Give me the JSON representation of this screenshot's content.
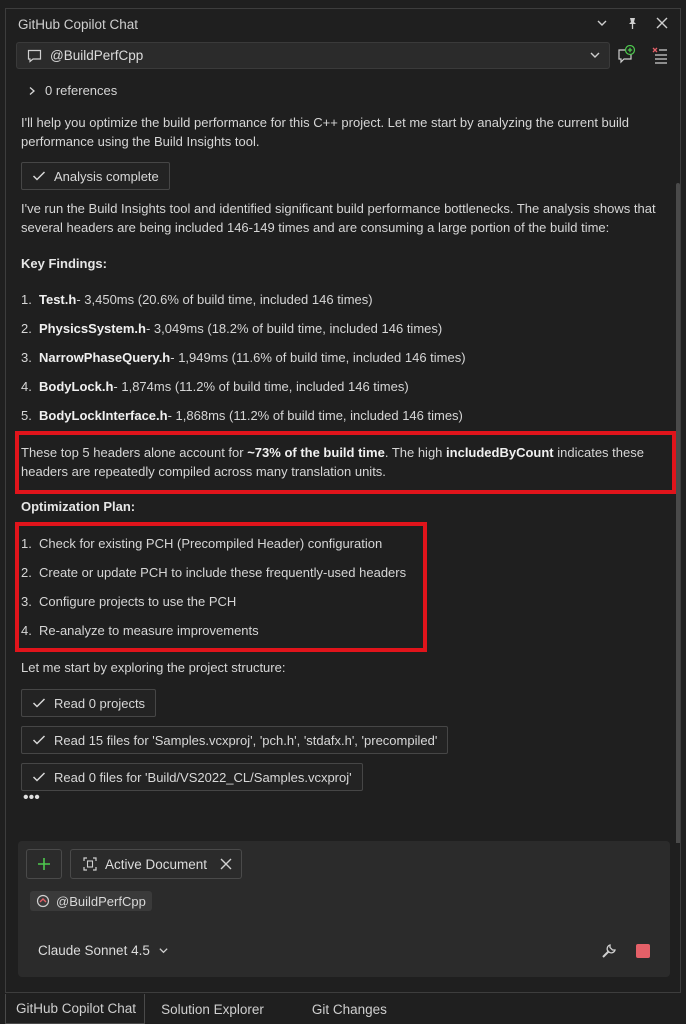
{
  "window": {
    "title": "GitHub Copilot Chat"
  },
  "agent_select": {
    "value": "@BuildPerfCpp"
  },
  "references": {
    "label": "0 references"
  },
  "intro": "I'll help you optimize the build performance for this C++ project. Let me start by analyzing the current build performance using the Build Insights tool.",
  "analysis_chip": "Analysis complete",
  "summary": "I've run the Build Insights tool and identified significant build performance bottlenecks. The analysis shows that several headers are being included 146-149 times and are consuming a large portion of the build time:",
  "findings": {
    "heading": "Key Findings:",
    "items": [
      {
        "num": "1.",
        "name": "Test.h",
        "detail": " - 3,450ms (20.6% of build time, included 146 times)"
      },
      {
        "num": "2.",
        "name": "PhysicsSystem.h",
        "detail": " - 3,049ms (18.2% of build time, included 146 times)"
      },
      {
        "num": "3.",
        "name": "NarrowPhaseQuery.h",
        "detail": " - 1,949ms (11.6% of build time, included 146 times)"
      },
      {
        "num": "4.",
        "name": "BodyLock.h",
        "detail": " - 1,874ms (11.2% of build time, included 146 times)"
      },
      {
        "num": "5.",
        "name": "BodyLockInterface.h",
        "detail": " - 1,868ms (11.2% of build time, included 146 times)"
      }
    ]
  },
  "highlight": {
    "part1": "These top 5 headers alone account for ",
    "bold1": "~73% of the build time",
    "part2": ". The high ",
    "bold2": "includedByCount",
    "part3": " indicates these headers are repeatedly compiled across many translation units."
  },
  "plan": {
    "heading": "Optimization Plan:",
    "items": [
      {
        "num": "1.",
        "text": "Check for existing PCH (Precompiled Header) configuration"
      },
      {
        "num": "2.",
        "text": "Create or update PCH to include these frequently-used headers"
      },
      {
        "num": "3.",
        "text": "Configure projects to use the PCH"
      },
      {
        "num": "4.",
        "text": "Re-analyze to measure improvements"
      }
    ]
  },
  "explore": "Let me start by exploring the project structure:",
  "tool_chips": [
    "Read 0 projects",
    "Read 15 files for 'Samples.vcxproj', 'pch.h', 'stdafx.h', 'precompiled'",
    "Read 0 files for 'Build/VS2022_CL/Samples.vcxproj'"
  ],
  "progress_dots": "•••",
  "input": {
    "doc_chip": "Active Document",
    "agent_tag": "@BuildPerfCpp",
    "model": "Claude Sonnet 4.5"
  },
  "tabs": [
    "GitHub Copilot Chat",
    "Solution Explorer",
    "Git Changes"
  ],
  "colors": {
    "highlight_border": "#e0141b",
    "add_green": "#4ec94e",
    "stop_red": "#e46068"
  }
}
